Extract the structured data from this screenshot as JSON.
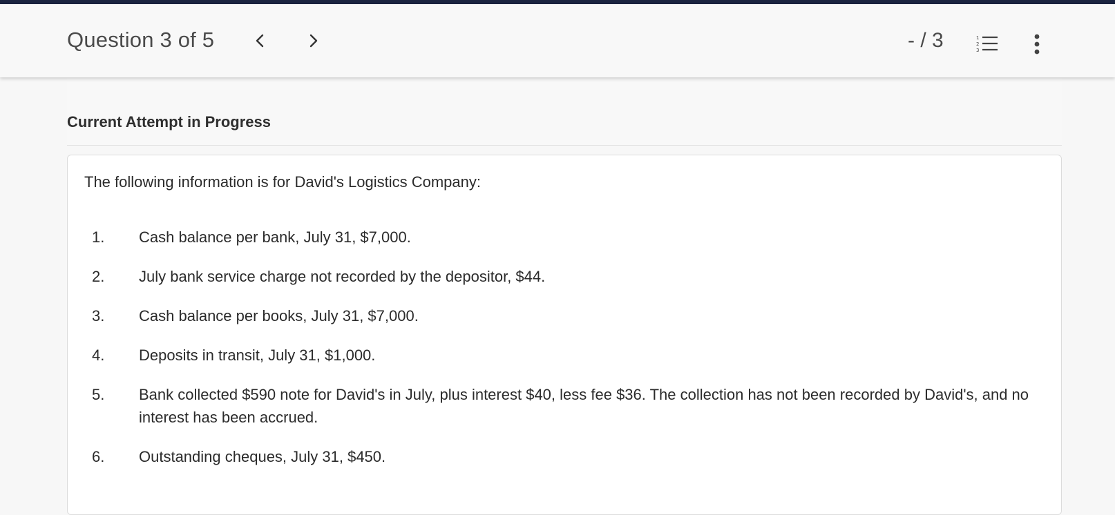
{
  "header": {
    "question_title": "Question 3 of 5",
    "score": "- / 3",
    "prev_icon": "chevron-left-icon",
    "next_icon": "chevron-right-icon",
    "list_icon": "numbered-list-icon",
    "more_icon": "more-vertical-icon"
  },
  "main": {
    "attempt_heading": "Current Attempt in Progress",
    "intro": "The following information is for David's Logistics Company:",
    "items": [
      {
        "num": "1.",
        "text": "Cash balance per bank, July 31, $7,000."
      },
      {
        "num": "2.",
        "text": "July bank service charge not recorded by the depositor, $44."
      },
      {
        "num": "3.",
        "text": "Cash balance per books, July 31, $7,000."
      },
      {
        "num": "4.",
        "text": "Deposits in transit, July 31, $1,000."
      },
      {
        "num": "5.",
        "text": "Bank collected $590 note for David's in July, plus interest $40, less fee $36. The collection has not been recorded by David's, and no interest has been accrued."
      },
      {
        "num": "6.",
        "text": "Outstanding cheques, July 31, $450."
      }
    ]
  },
  "colors": {
    "top_bar": "#1b2440",
    "header_bg": "#f8f8f8",
    "text": "#2b2b2b",
    "card_bg": "#ffffff"
  }
}
